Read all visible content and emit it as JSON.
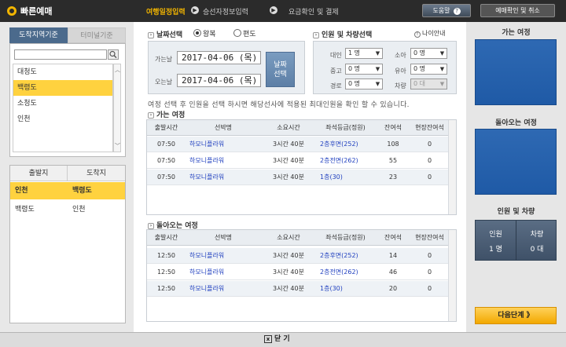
{
  "app": {
    "title": "빠른예매"
  },
  "steps": [
    {
      "label": "여행일정입력",
      "active": true
    },
    {
      "label": "승선자정보입력",
      "active": false
    },
    {
      "label": "요금확인 및 결제",
      "active": false
    }
  ],
  "header": {
    "help_label": "도움말",
    "help_icon": "?",
    "reservation_label": "예매확인 및 취소"
  },
  "left": {
    "tabs": [
      "도착지역기준",
      "터미널기준"
    ],
    "search_placeholder": "",
    "regions": [
      "대청도",
      "백령도",
      "소청도",
      "인천"
    ],
    "selected_region_index": 1,
    "port_headers": [
      "출발지",
      "도착지"
    ],
    "routes": [
      {
        "from": "인천",
        "to": "백령도",
        "selected": true
      },
      {
        "from": "백령도",
        "to": "인천",
        "selected": false
      }
    ]
  },
  "date_section": {
    "title": "날짜선택",
    "trip_types": [
      "왕복",
      "편도"
    ],
    "selected_trip": "왕복",
    "depart_label": "가는날",
    "depart_value": "2017-04-06 (목)",
    "return_label": "오는날",
    "return_value": "2017-04-06 (목)",
    "select_button": [
      "날짜",
      "선택"
    ]
  },
  "pax_section": {
    "title": "인원 및 차량선택",
    "age_guide": "나이안내",
    "fields": [
      {
        "label": "대인",
        "value": "1 명",
        "disabled": false
      },
      {
        "label": "소아",
        "value": "0 명",
        "disabled": false
      },
      {
        "label": "중고",
        "value": "0 명",
        "disabled": false
      },
      {
        "label": "유아",
        "value": "0 명",
        "disabled": false
      },
      {
        "label": "경로",
        "value": "0 명",
        "disabled": false
      },
      {
        "label": "차량",
        "value": "0 대",
        "disabled": true
      }
    ]
  },
  "notice": "여정 선택 후 인원을 선택 하시면 해당선사에 적용된 최대인원을 확인 할 수 있습니다.",
  "outbound": {
    "title": "가는 여정",
    "headers": [
      "출발시간",
      "선박명",
      "소요시간",
      "좌석등급(정원)",
      "잔여석",
      "현장잔여석"
    ],
    "rows": [
      {
        "time": "07:50",
        "ship": "하모니플라워",
        "duration": "3시간 40분",
        "grade": "2층후면(252)",
        "remain": "108",
        "onsite": "0"
      },
      {
        "time": "07:50",
        "ship": "하모니플라워",
        "duration": "3시간 40분",
        "grade": "2층전면(262)",
        "remain": "55",
        "onsite": "0"
      },
      {
        "time": "07:50",
        "ship": "하모니플라워",
        "duration": "3시간 40분",
        "grade": "1층(30)",
        "remain": "23",
        "onsite": "0"
      }
    ]
  },
  "inbound": {
    "title": "돌아오는 여정",
    "headers": [
      "출발시간",
      "선박명",
      "소요시간",
      "좌석등급(정원)",
      "잔여석",
      "현장잔여석"
    ],
    "rows": [
      {
        "time": "12:50",
        "ship": "하모니플라워",
        "duration": "3시간 40분",
        "grade": "2층후면(252)",
        "remain": "14",
        "onsite": "0"
      },
      {
        "time": "12:50",
        "ship": "하모니플라워",
        "duration": "3시간 40분",
        "grade": "2층전면(262)",
        "remain": "46",
        "onsite": "0"
      },
      {
        "time": "12:50",
        "ship": "하모니플라워",
        "duration": "3시간 40분",
        "grade": "1층(30)",
        "remain": "20",
        "onsite": "0"
      }
    ]
  },
  "summary": {
    "outbound_title": "가는 여정",
    "inbound_title": "돌아오는 여정",
    "pax_title": "인원 및 차량",
    "pax_label": "인원",
    "pax_value": "1 명",
    "vehicle_label": "차량",
    "vehicle_value": "0 대",
    "next_label": "다음단계 》"
  },
  "footer": {
    "close_label": "닫 기",
    "close_icon": "x"
  },
  "colors": {
    "accent": "#f2b500",
    "selected_row": "#ffd23f",
    "panel_blue": "#1f5aa6",
    "link": "#1f3fbf"
  }
}
